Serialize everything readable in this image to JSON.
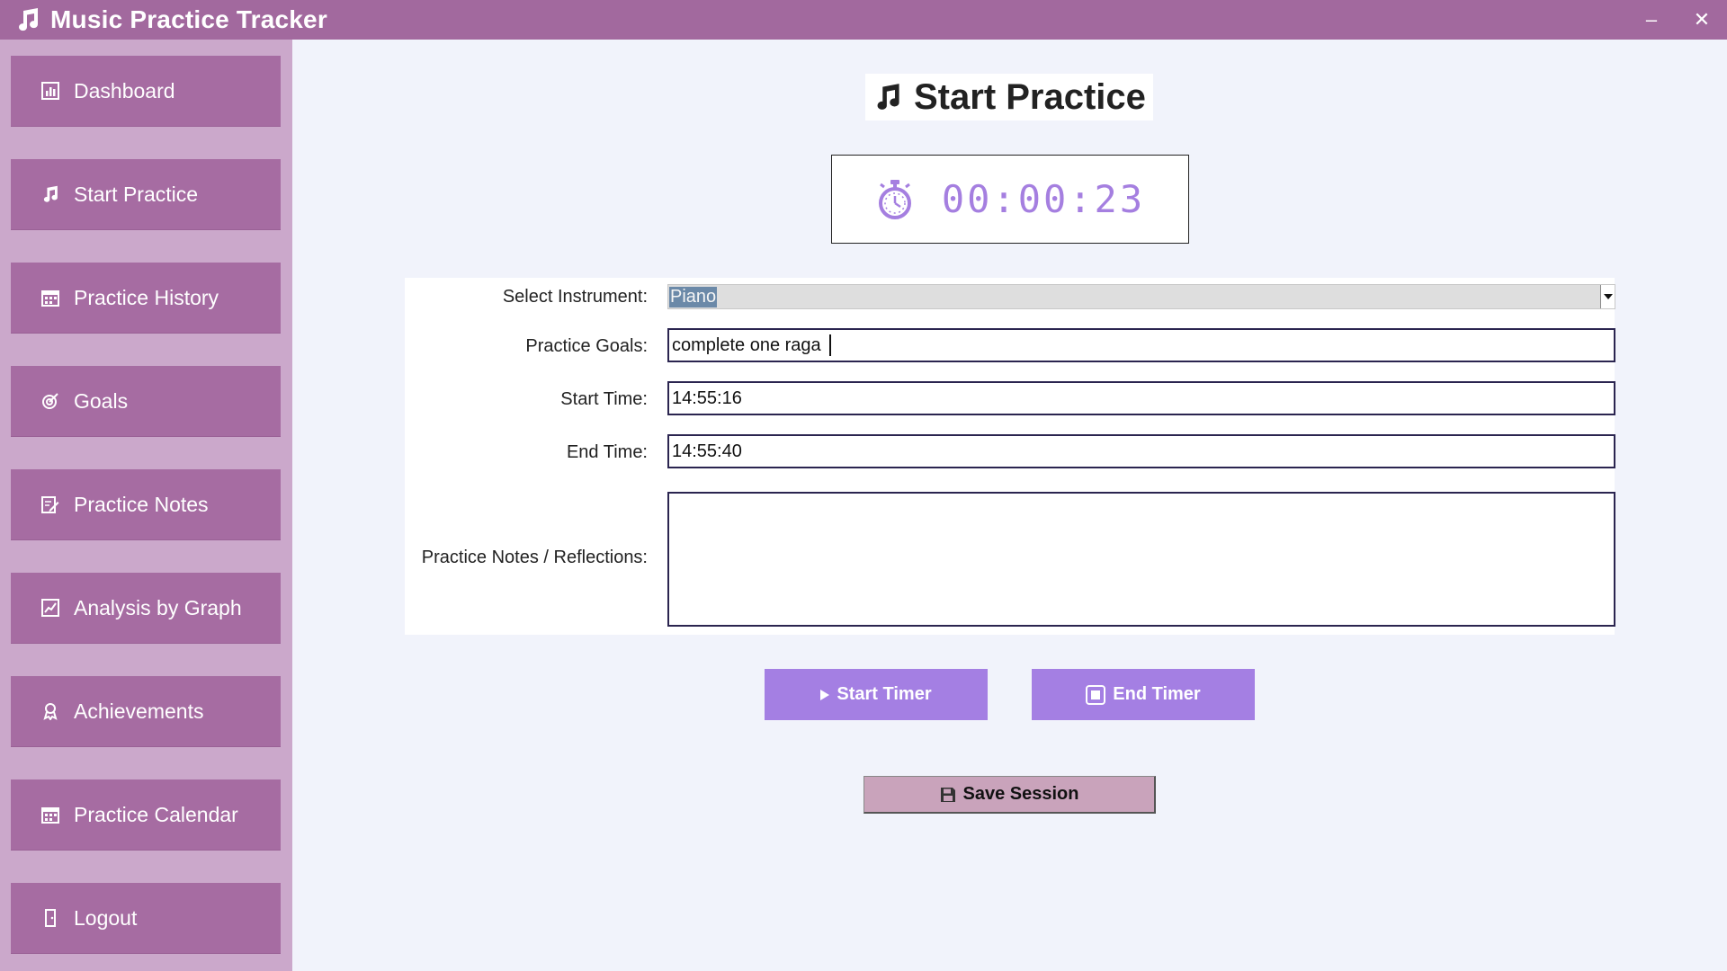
{
  "window": {
    "title": "Music Practice Tracker",
    "icon": "music-note-icon",
    "minimize_label": "–",
    "close_label": "✕"
  },
  "sidebar": {
    "items": [
      {
        "label": "Dashboard",
        "icon": "bar-chart-icon"
      },
      {
        "label": "Start Practice",
        "icon": "music-note-icon"
      },
      {
        "label": "Practice History",
        "icon": "calendar-icon"
      },
      {
        "label": "Goals",
        "icon": "target-icon"
      },
      {
        "label": "Practice Notes",
        "icon": "note-edit-icon"
      },
      {
        "label": "Analysis by Graph",
        "icon": "line-chart-icon"
      },
      {
        "label": "Achievements",
        "icon": "trophy-icon"
      },
      {
        "label": "Practice Calendar",
        "icon": "calendar-icon"
      },
      {
        "label": "Logout",
        "icon": "door-icon"
      }
    ]
  },
  "main": {
    "title": "Start Practice",
    "timer": "00:00:23",
    "form": {
      "instrument_label": "Select Instrument:",
      "instrument_value": "Piano",
      "goals_label": "Practice Goals:",
      "goals_value": "complete one raga ",
      "start_label": "Start Time:",
      "start_value": "14:55:16",
      "end_label": "End Time:",
      "end_value": "14:55:40",
      "notes_label": "Practice Notes / Reflections:",
      "notes_value": ""
    },
    "buttons": {
      "start_timer": "Start Timer",
      "end_timer": "End Timer",
      "save_session": "Save Session"
    }
  },
  "colors": {
    "titlebar": "#a2699e",
    "sidebar_bg": "#cba8cb",
    "nav_item": "#a66ca2",
    "accent_purple": "#a47fe3",
    "timer_text": "#a57fe0",
    "save_button": "#c9a3bb"
  }
}
